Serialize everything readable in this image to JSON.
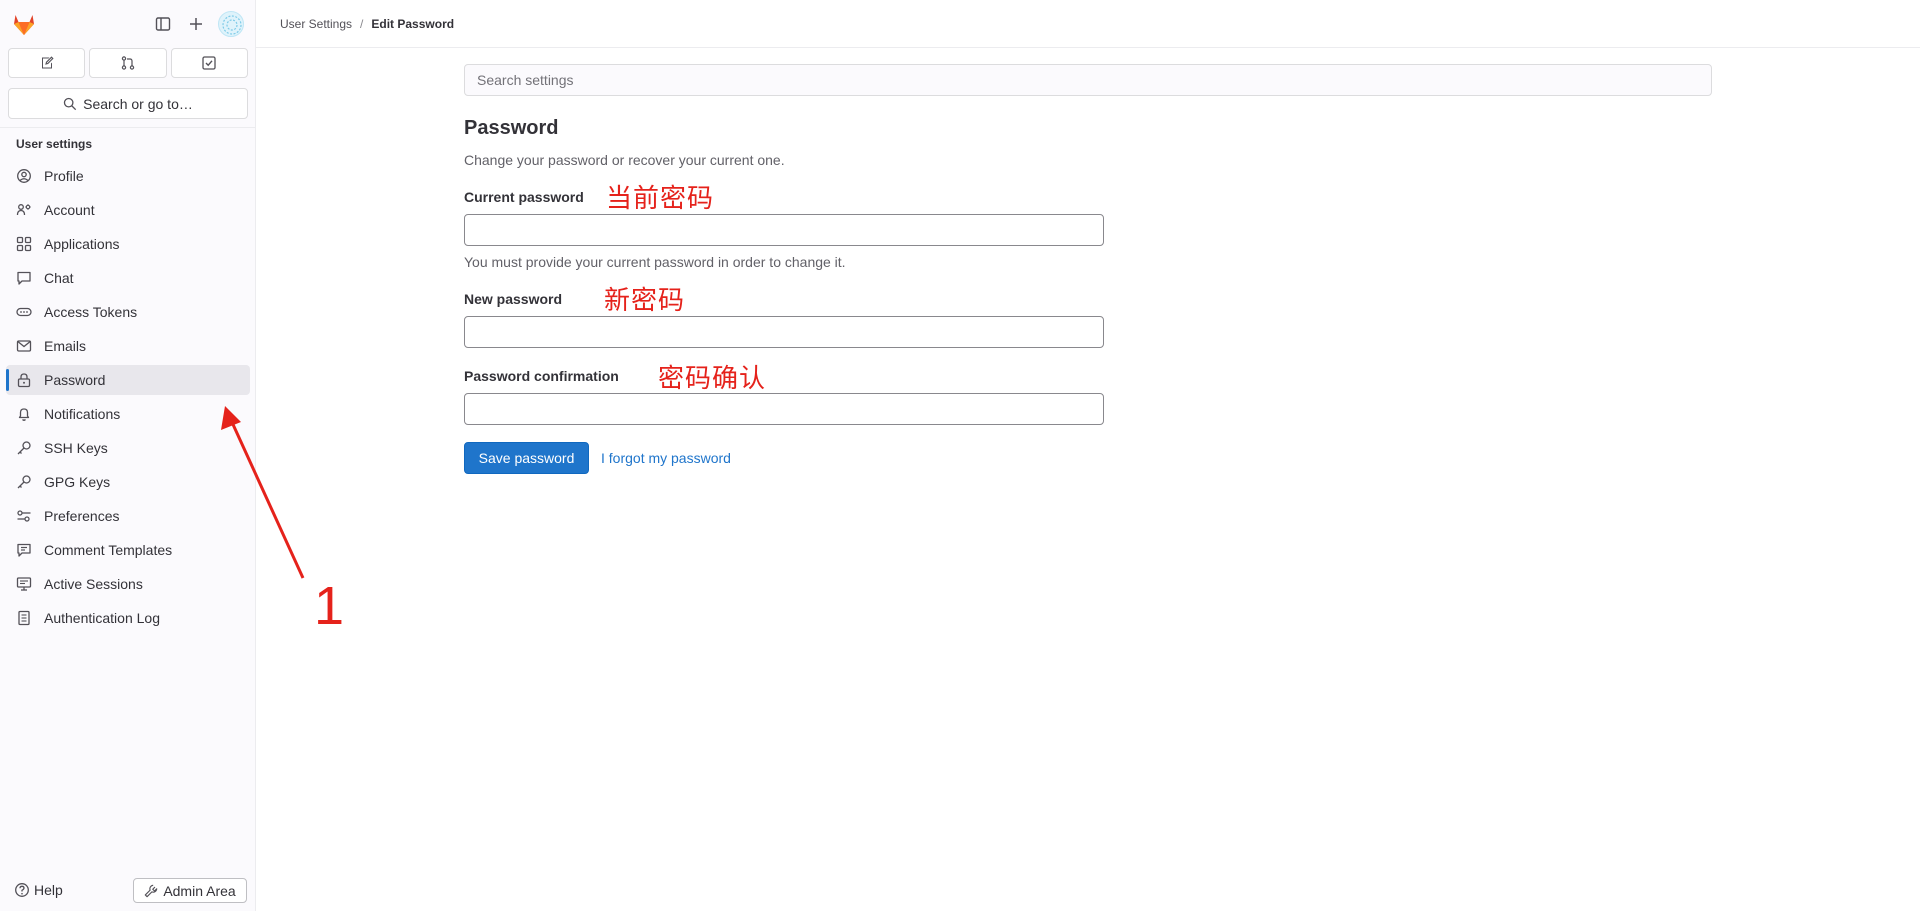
{
  "sidebar": {
    "section_title": "User settings",
    "search_label": "Search or go to…",
    "quick_actions": [
      {
        "icon": "issues-icon"
      },
      {
        "icon": "merge-request-icon"
      },
      {
        "icon": "todo-icon"
      }
    ],
    "items": [
      {
        "label": "Profile",
        "icon": "profile-icon"
      },
      {
        "label": "Account",
        "icon": "account-icon"
      },
      {
        "label": "Applications",
        "icon": "applications-icon"
      },
      {
        "label": "Chat",
        "icon": "chat-icon"
      },
      {
        "label": "Access Tokens",
        "icon": "token-icon"
      },
      {
        "label": "Emails",
        "icon": "mail-icon"
      },
      {
        "label": "Password",
        "icon": "lock-icon",
        "active": true
      },
      {
        "label": "Notifications",
        "icon": "bell-icon"
      },
      {
        "label": "SSH Keys",
        "icon": "key-icon"
      },
      {
        "label": "GPG Keys",
        "icon": "key-icon"
      },
      {
        "label": "Preferences",
        "icon": "preferences-icon"
      },
      {
        "label": "Comment Templates",
        "icon": "comment-icon"
      },
      {
        "label": "Active Sessions",
        "icon": "monitor-icon"
      },
      {
        "label": "Authentication Log",
        "icon": "log-icon"
      }
    ],
    "help_label": "Help",
    "admin_label": "Admin Area"
  },
  "breadcrumb": {
    "parent": "User Settings",
    "separator": "/",
    "current": "Edit Password"
  },
  "main": {
    "search_placeholder": "Search settings",
    "title": "Password",
    "subtitle": "Change your password or recover your current one.",
    "current_password_label": "Current password",
    "current_password_help": "You must provide your current password in order to change it.",
    "new_password_label": "New password",
    "confirmation_label": "Password confirmation",
    "save_button": "Save password",
    "forgot_link": "I forgot my password"
  },
  "annotations": {
    "current_password": "当前密码",
    "new_password": "新密码",
    "confirmation": "密码确认",
    "step_number": "1",
    "color": "#e5221b"
  },
  "colors": {
    "accent": "#1f75cb",
    "sidebar_bg": "#fbfafd",
    "active_item_bg": "#e8e7ec",
    "logo_orange": "#e24329"
  }
}
